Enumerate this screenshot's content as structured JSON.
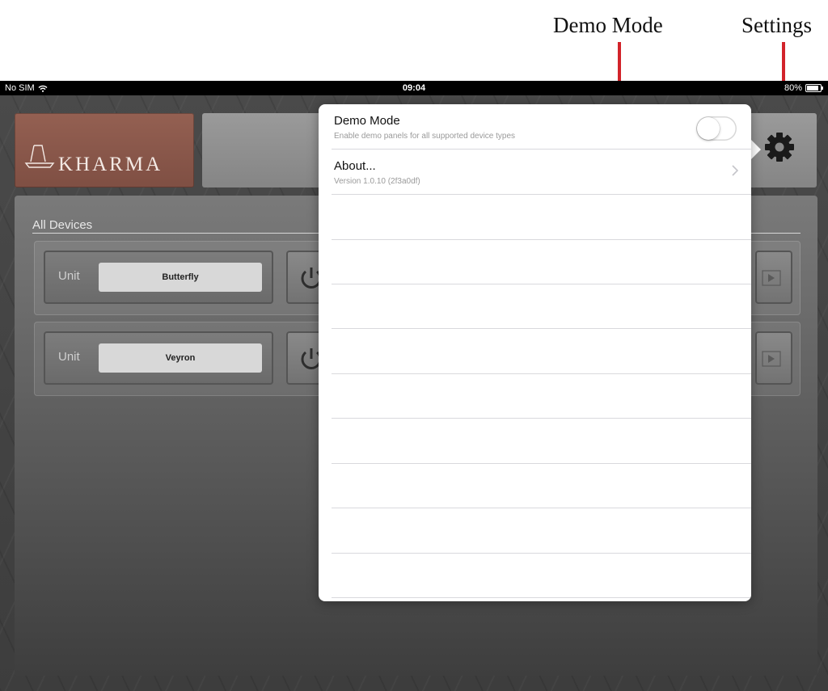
{
  "annotations": {
    "demo_mode": "Demo Mode",
    "settings": "Settings"
  },
  "status_bar": {
    "carrier": "No SIM",
    "time": "09:04",
    "battery": "80%"
  },
  "header": {
    "logo_text": "KHARMA"
  },
  "main": {
    "section_title": "All Devices",
    "devices": [
      {
        "unit_label": "Unit",
        "name": "Butterfly"
      },
      {
        "unit_label": "Unit",
        "name": "Veyron"
      }
    ]
  },
  "popover": {
    "demo_mode": {
      "title": "Demo Mode",
      "subtitle": "Enable demo panels for all supported device types",
      "enabled": false
    },
    "about": {
      "title": "About...",
      "subtitle": "Version 1.0.10 (2f3a0df)"
    }
  },
  "colors": {
    "annotation_arrow": "#d2232a",
    "logo_background": "#8a5849",
    "toggle_border": "#d8d8d8"
  }
}
